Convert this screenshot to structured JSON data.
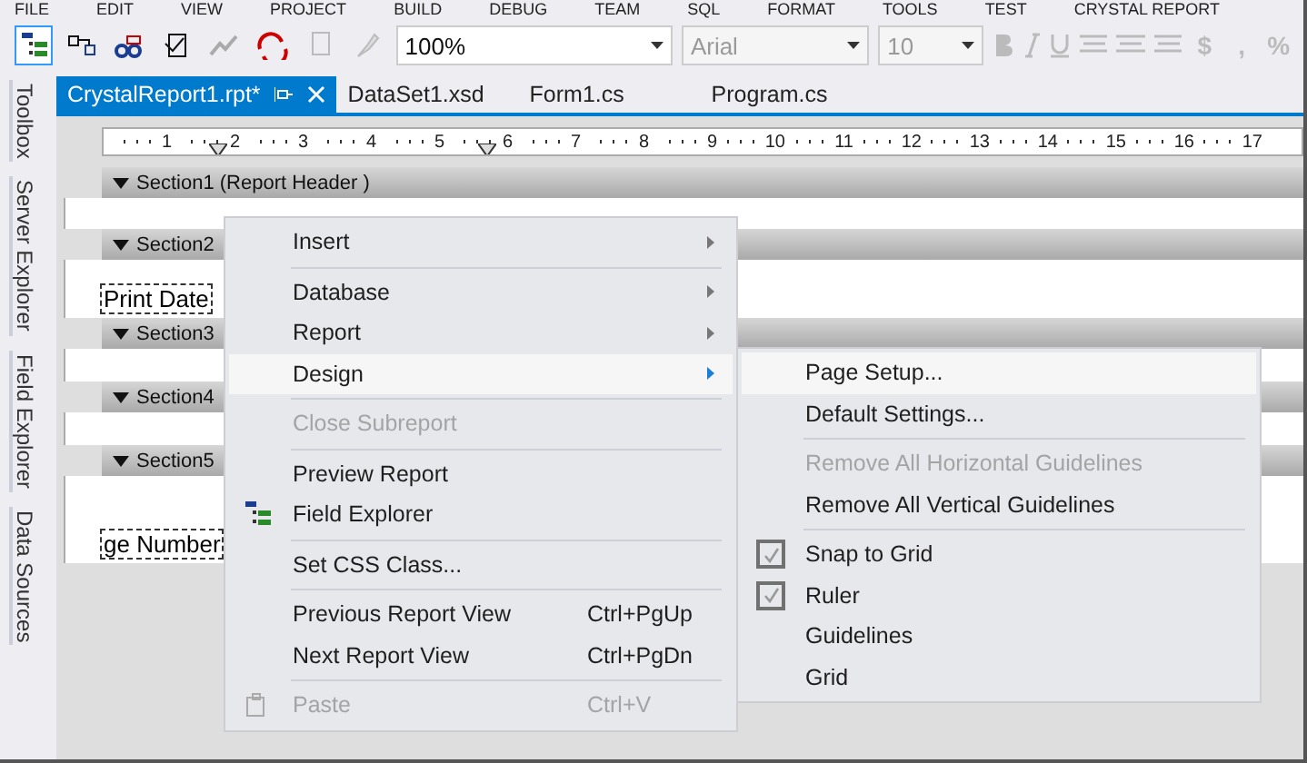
{
  "menu_bar": [
    "FILE",
    "EDIT",
    "VIEW",
    "PROJECT",
    "BUILD",
    "DEBUG",
    "TEAM",
    "SQL",
    "FORMAT",
    "TOOLS",
    "TEST",
    "CRYSTAL REPORT"
  ],
  "toolbar": {
    "zoom": "100%",
    "font": {
      "value": "Arial",
      "disabled": true
    },
    "size": {
      "value": "10",
      "disabled": true
    },
    "symbols": [
      "$",
      ",",
      "%"
    ]
  },
  "side_tabs": [
    "Toolbox",
    "Server Explorer",
    "Field Explorer",
    "Data Sources"
  ],
  "tabs": [
    {
      "label": "CrystalReport1.rpt*",
      "selected": true
    },
    {
      "label": "DataSet1.xsd",
      "selected": false
    },
    {
      "label": "Form1.cs",
      "selected": false
    },
    {
      "label": "Program.cs",
      "selected": false
    }
  ],
  "ruler": [
    "1",
    "2",
    "3",
    "4",
    "5",
    "6",
    "7",
    "8",
    "9",
    "10",
    "11",
    "12",
    "13",
    "14",
    "15",
    "16",
    "17"
  ],
  "sections": [
    {
      "label": "Section1 (Report Header )"
    },
    {
      "label": "Section2",
      "field": "Print Date"
    },
    {
      "label": "Section3"
    },
    {
      "label": "Section4"
    },
    {
      "label": "Section5",
      "field": "ge Number"
    }
  ],
  "context_menu": [
    {
      "kind": "item",
      "label": "Insert",
      "submenu": true,
      "selected": false,
      "disabled": false
    },
    {
      "kind": "separator"
    },
    {
      "kind": "item",
      "label": "Database",
      "submenu": true,
      "selected": false,
      "disabled": false
    },
    {
      "kind": "item",
      "label": "Report",
      "submenu": true,
      "selected": false,
      "disabled": false
    },
    {
      "kind": "item",
      "label": "Design",
      "submenu": true,
      "selected": true,
      "disabled": false
    },
    {
      "kind": "separator"
    },
    {
      "kind": "item",
      "label": "Close Subreport",
      "selected": false,
      "disabled": true
    },
    {
      "kind": "separator"
    },
    {
      "kind": "item",
      "label": "Preview Report",
      "selected": false,
      "disabled": false
    },
    {
      "kind": "tree-item",
      "label": "Field Explorer",
      "selected": false,
      "disabled": false
    },
    {
      "kind": "separator"
    },
    {
      "kind": "item",
      "label": "Set CSS Class...",
      "selected": false,
      "disabled": false
    },
    {
      "kind": "separator"
    },
    {
      "kind": "item",
      "label": "Previous Report View",
      "shortcut": "Ctrl+PgUp",
      "selected": false,
      "disabled": false
    },
    {
      "kind": "item",
      "label": "Next Report View",
      "shortcut": "Ctrl+PgDn",
      "selected": false,
      "disabled": false
    },
    {
      "kind": "separator"
    },
    {
      "kind": "clipboard-item",
      "label": "Paste",
      "shortcut": "Ctrl+V",
      "selected": false,
      "disabled": true
    }
  ],
  "submenu": [
    {
      "kind": "item",
      "label": "Page Setup...",
      "selected": true,
      "disabled": false
    },
    {
      "kind": "item",
      "label": "Default Settings...",
      "selected": false,
      "disabled": false
    },
    {
      "kind": "separator"
    },
    {
      "kind": "item",
      "label": "Remove All Horizontal Guidelines",
      "selected": false,
      "disabled": true
    },
    {
      "kind": "item",
      "label": "Remove All Vertical Guidelines",
      "selected": false,
      "disabled": false
    },
    {
      "kind": "separator"
    },
    {
      "kind": "check",
      "label": "Snap to Grid",
      "checked": true,
      "selected": false,
      "disabled": false
    },
    {
      "kind": "check",
      "label": "Ruler",
      "checked": true,
      "selected": false,
      "disabled": false
    },
    {
      "kind": "check",
      "label": "Guidelines",
      "checked": false,
      "selected": false,
      "disabled": false
    },
    {
      "kind": "check",
      "label": "Grid",
      "checked": false,
      "selected": false,
      "disabled": false
    }
  ]
}
